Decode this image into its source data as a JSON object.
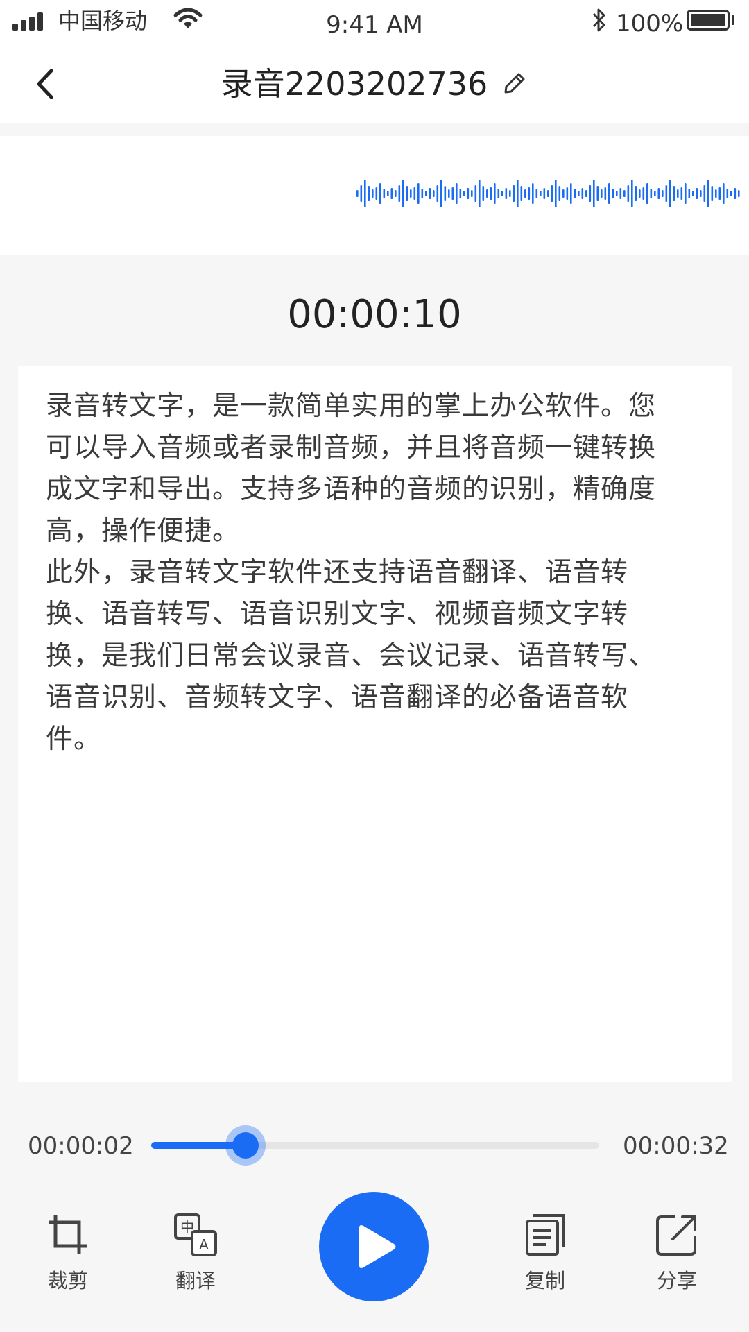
{
  "status_bar": {
    "carrier": "中国移动",
    "time": "9:41 AM",
    "battery": "100%"
  },
  "header": {
    "title": "录音2203202736",
    "back_icon": "chevron-left-icon",
    "edit_icon": "pencil-icon"
  },
  "recording_time": "00:00:10",
  "transcript": "录音转文字，是一款简单实用的掌上办公软件。您\n可以导入音频或者录制音频，并且将音频一键转换\n成文字和导出。支持多语种的音频的识别，精确度\n高，操作便捷。\n此外，录音转文字软件还支持语音翻译、语音转\n换、语音转写、语音识别文字、视频音频文字转\n换，是我们日常会议录音、会议记录、语音转写、\n语音识别、音频转文字、语音翻译的必备语音软\n件。",
  "player": {
    "current_time": "00:00:02",
    "total_time": "00:00:32",
    "progress": 0.18
  },
  "toolbar": {
    "crop_label": "裁剪",
    "translate_label": "翻译",
    "copy_label": "复制",
    "share_label": "分享"
  },
  "colors": {
    "accent": "#1a6cf5",
    "background": "#f6f6f6",
    "card": "#ffffff"
  }
}
